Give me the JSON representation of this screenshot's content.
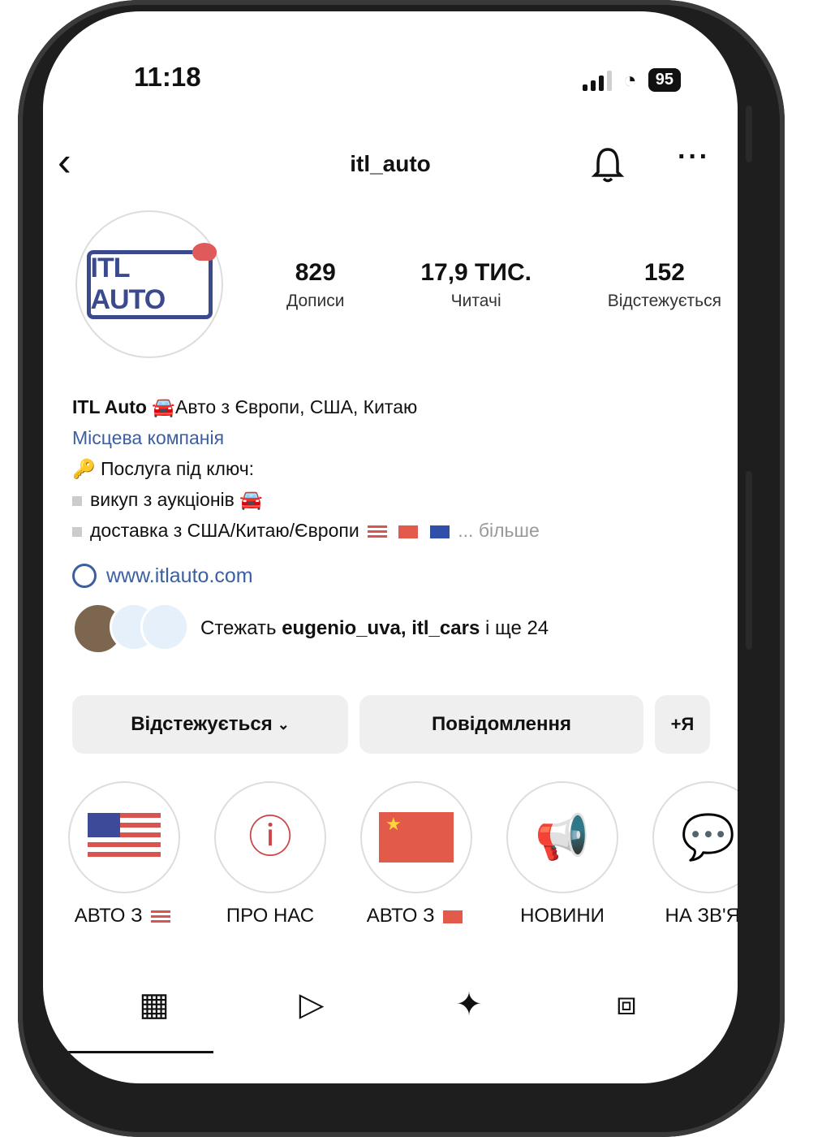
{
  "status": {
    "time": "11:18",
    "battery": "95"
  },
  "header": {
    "username": "itl_auto"
  },
  "profile": {
    "logo_text": "ITL AUTO",
    "stats": [
      {
        "value": "829",
        "label": "Дописи"
      },
      {
        "value": "17,9 ТИС.",
        "label": "Читачі"
      },
      {
        "value": "152",
        "label": "Відстежується"
      }
    ],
    "bio": {
      "name": "ITL Auto",
      "name_rest": "🚘Авто з Європи, США, Китаю",
      "category": "Місцева компанія",
      "line1": "🔑 Послуга під ключ:",
      "line2": "викуп з аукціонів 🚘",
      "line3": "доставка з США/Китаю/Європи",
      "more": "... більше"
    },
    "website": "www.itlauto.com",
    "followed_by_prefix": "Стежать",
    "followed_by_names": "eugenio_uva, itl_cars",
    "followed_by_suffix": "і ще 24"
  },
  "actions": {
    "follow_label": "Відстежується",
    "message_label": "Повідомлення",
    "add_label": "+Я"
  },
  "highlights": [
    {
      "label": "АВТО З"
    },
    {
      "label": "ПРО НАС"
    },
    {
      "label": "АВТО З"
    },
    {
      "label": "НОВИНИ"
    },
    {
      "label": "НА ЗВ'ЯЗ"
    }
  ],
  "colors": {
    "accent": "#3b5fa0",
    "brand": "#3b4a8c",
    "highlight_icon": "#c44444"
  },
  "icons": [
    "back-icon",
    "bell-icon",
    "more-icon",
    "grid-icon",
    "reels-icon",
    "sparkle-icon",
    "tagged-icon"
  ]
}
